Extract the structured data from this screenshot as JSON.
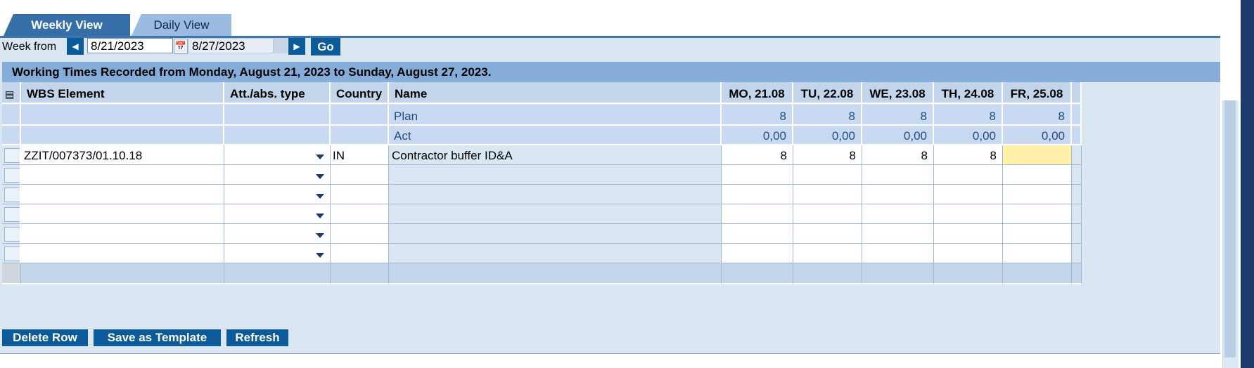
{
  "tabs": [
    {
      "label": "Weekly View",
      "active": true
    },
    {
      "label": "Daily View",
      "active": false
    }
  ],
  "week": {
    "label": "Week from",
    "from": "8/21/2023",
    "to": "8/27/2023",
    "go_label": "Go",
    "prev_icon": "triangle-left-icon",
    "next_icon": "triangle-right-icon",
    "calendar_icon": "calendar-icon"
  },
  "title": "Working Times Recorded from Monday, August 21, 2023 to Sunday, August 27, 2023.",
  "columns": {
    "wbs": "WBS Element",
    "att": "Att./abs. type",
    "country": "Country",
    "name": "Name",
    "days": [
      "MO, 21.08",
      "TU, 22.08",
      "WE, 23.08",
      "TH, 24.08",
      "FR, 25.08"
    ]
  },
  "plan": {
    "label": "Plan",
    "values": [
      "8",
      "8",
      "8",
      "8",
      "8"
    ]
  },
  "act": {
    "label": "Act",
    "values": [
      "0,00",
      "0,00",
      "0,00",
      "0,00",
      "0,00"
    ]
  },
  "entries": [
    {
      "wbs": "ZZIT/007373/01.10.18",
      "att": "",
      "country": "IN",
      "name": "Contractor buffer ID&A",
      "hours": [
        "8",
        "8",
        "8",
        "8",
        ""
      ]
    }
  ],
  "buttons": {
    "delete": "Delete Row",
    "save_template": "Save as Template",
    "refresh": "Refresh"
  },
  "colors": {
    "primary": "#0b5a9a",
    "header": "#c3d5ea",
    "title_bar": "#86acd9",
    "highlight": "#fff2a8"
  }
}
